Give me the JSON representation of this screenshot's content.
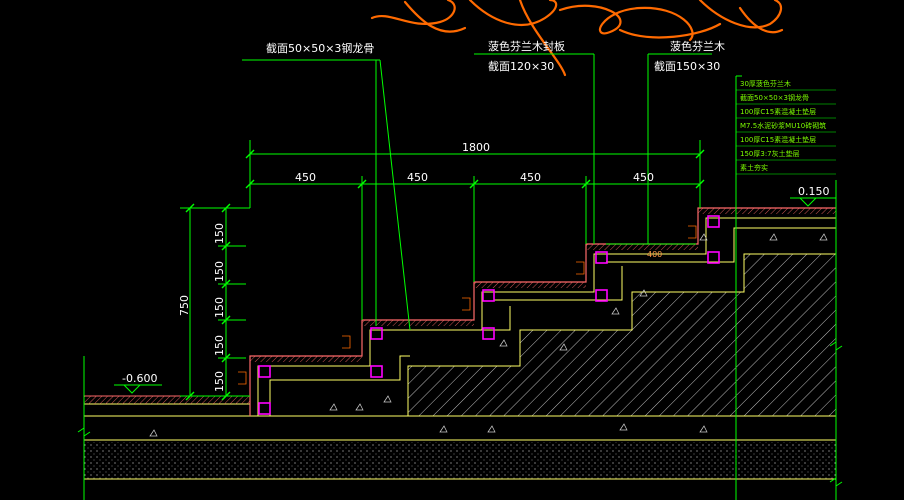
{
  "drawing": {
    "callouts": {
      "steel_frame": "截面50×50×3钢龙骨",
      "tread_edge": "菠色芬兰木封板",
      "tread_edge_size": "截面120×30",
      "tread_board": "菠色芬兰木",
      "tread_board_size": "截面150×30"
    },
    "dims": {
      "total_width": "1800",
      "step_widths": [
        "450",
        "450",
        "450",
        "450"
      ],
      "step_risers": [
        "150",
        "150",
        "150",
        "150",
        "150"
      ],
      "total_height": "750",
      "inner_width": "400"
    },
    "levels": {
      "top": "0.150",
      "bottom": "-0.600"
    },
    "layer_notes": [
      "30厚菠色芬兰木",
      "截面50×50×3钢龙骨",
      "100厚C15素混凝土垫层",
      "M7.5水泥砂浆MU10砖砌筑",
      "100厚C15素混凝土垫层",
      "150厚3:7灰土垫层",
      "素土夯实"
    ],
    "colors": {
      "background": "#000000",
      "dim_line": "#00ff00",
      "outline": "#ffff66",
      "frame": "#ff00ff",
      "wood": "#ff6a6a",
      "annotation": "#ff6a00"
    }
  }
}
